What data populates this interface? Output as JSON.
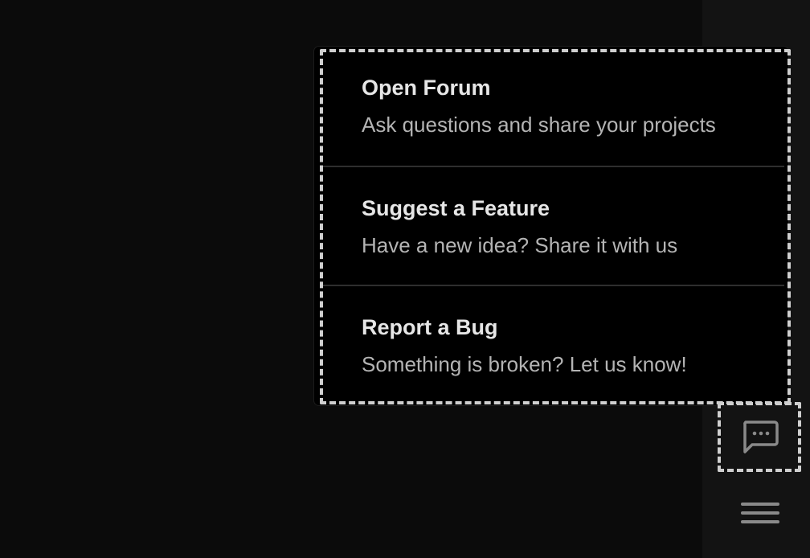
{
  "menu": {
    "items": [
      {
        "title": "Open Forum",
        "description": "Ask questions and share your projects"
      },
      {
        "title": "Suggest a Feature",
        "description": "Have a new idea? Share it with us"
      },
      {
        "title": "Report a Bug",
        "description": "Something is broken? Let us know!"
      }
    ]
  },
  "rail": {
    "chat_button_icon": "chat-bubble-icon",
    "menu_button_icon": "hamburger-menu-icon"
  },
  "colors": {
    "background": "#0b0b0b",
    "rail": "#131313",
    "popup": "#000000",
    "title_text": "#e6e6e6",
    "description_text": "#b4b4b4",
    "icon": "#8a8a8a",
    "focus_outline": "#cfcfcf"
  }
}
